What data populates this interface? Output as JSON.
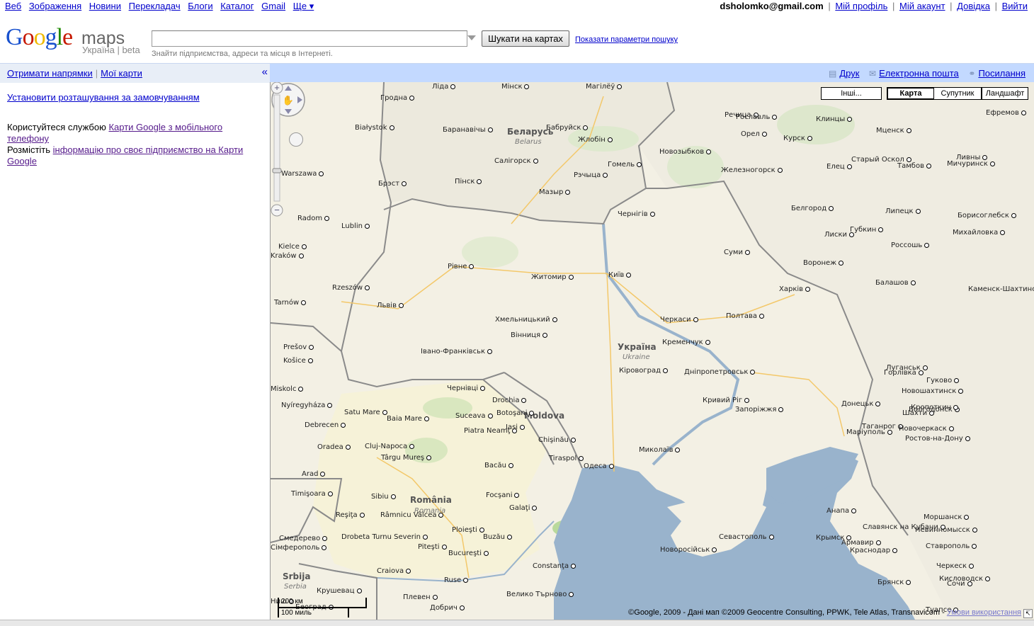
{
  "top_nav": {
    "links": [
      "Веб",
      "Зображення",
      "Новини",
      "Перекладач",
      "Блоги",
      "Каталог",
      "Gmail",
      "Ще ▾"
    ]
  },
  "user_nav": {
    "email": "dsholomko@gmail.com",
    "links": [
      "Мій профіль",
      "Мій акаунт",
      "Довідка",
      "Вийти"
    ]
  },
  "logo": {
    "google": "Google",
    "maps": "maps",
    "subtitle": "Україна | beta"
  },
  "search": {
    "value": "",
    "button": "Шукати на картах",
    "options_link": "Показати параметри пошуку",
    "hint": "Знайти підприємства, адреси та місця в Інтернеті."
  },
  "left_panel": {
    "tabs": [
      "Отримати напрямки",
      "Мої карти"
    ],
    "collapse_icon": "«",
    "set_location_link": "Установити розташування за замовчуванням",
    "mobile_prefix": "Користуйтеся службою ",
    "mobile_link": "Карти Google з мобільного телефону",
    "business_prefix": "Розмістіть ",
    "business_link": "інформацію про своє підприємство на Карти Google"
  },
  "map_bar": {
    "print": "Друк",
    "email": "Електронна пошта",
    "link": "Посилання"
  },
  "map_types": {
    "more": "Інші...",
    "map": "Карта",
    "satellite": "Супутник",
    "terrain": "Ландшафт",
    "selected": "Карта"
  },
  "scale": {
    "km": "200 км",
    "miles": "100 миль"
  },
  "copyright": {
    "text": "©Google, 2009 - Дані мап ©2009 Geocentre Consulting, PPWK, Tele Atlas, Transnavicom - ",
    "terms": "Умови використання"
  },
  "countries": [
    {
      "name": "Беларусь",
      "latin": "Belarus"
    },
    {
      "name": "Україна",
      "latin": "Ukraine"
    },
    {
      "name": "România",
      "latin": "Romania"
    },
    {
      "name": "Moldova",
      "latin": ""
    },
    {
      "name": "Srbija",
      "latin": "Serbia"
    }
  ],
  "places": [
    "Ліда",
    "Мінск",
    "Магілёў",
    "Гродна",
    "Баранавічы",
    "Бабруйск",
    "Жлобін",
    "Салігорск",
    "Гомель",
    "Рэчыца",
    "Мазыр",
    "Пінск",
    "Брэст",
    "Białystok",
    "Warszawa",
    "Lublin",
    "Radom",
    "Kielce",
    "Rzeszów",
    "Tarnów",
    "Kraków",
    "Чернігів",
    "Рівне",
    "Житомир",
    "Київ",
    "Суми",
    "Хмельницький",
    "Вінниця",
    "Черкаси",
    "Полтава",
    "Харків",
    "Кременчук",
    "Івано-Франківськ",
    "Кіровоград",
    "Дніпропетровськ",
    "Луганськ",
    "Горлівка",
    "Донецьк",
    "Кривий Ріг",
    "Запоріжжя",
    "Миколаїв",
    "Одеса",
    "Маріуполь",
    "Таганрог",
    "Ростов-на-Дону",
    "Шахти",
    "Новочеркаск",
    "Волгодонск",
    "Чернівці",
    "Львів",
    "Prešov",
    "Košice",
    "Miskolc",
    "Nyíregyháza",
    "Debrecen",
    "Oradea",
    "Satu Mare",
    "Baia Mare",
    "Drochia",
    "Botoşani",
    "Suceava",
    "Iaşi",
    "Piatra Neamţ",
    "Chişinău",
    "Tiraspol",
    "Cluj-Napoca",
    "Târgu Mureş",
    "Bacău",
    "Arad",
    "Timişoara",
    "Sibiu",
    "Focşani",
    "Galaţi",
    "Reşiţa",
    "Râmnicu Vâlcea",
    "Ploieşti",
    "Buzău",
    "Drobeta Turnu Severin",
    "Piteşti",
    "Bucureşti",
    "Craiova",
    "Constanţa",
    "Ruse",
    "Плевен",
    "Велико Търново",
    "Добрич",
    "Крушевац",
    "Ниш",
    "Београд",
    "Смедерево",
    "Сімферополь",
    "Севастополь",
    "Новоросійськ",
    "Краснодар",
    "Славянск на Кубани",
    "Анапа",
    "Крымск",
    "Армавир",
    "Невинномысск",
    "Ставрополь",
    "Черкеск",
    "Кисловодск",
    "Сочи",
    "Туапсе",
    "Брянск",
    "Орел",
    "Курск",
    "Белгород",
    "Воронеж",
    "Липецк",
    "Тамбов",
    "Мичуринск",
    "Ливны",
    "Елец",
    "Старый Оскол",
    "Губкин",
    "Лиски",
    "Россошь",
    "Балашов",
    "Борисоглебск",
    "Михайловка",
    "Каменск-Шахтинский",
    "Гуково",
    "Новошахтинск",
    "Кропоткин",
    "Моршанск",
    "Ефремов",
    "Мценск",
    "Клинцы",
    "Новозыбков",
    "Железногорск",
    "Речица",
    "Рославль"
  ]
}
